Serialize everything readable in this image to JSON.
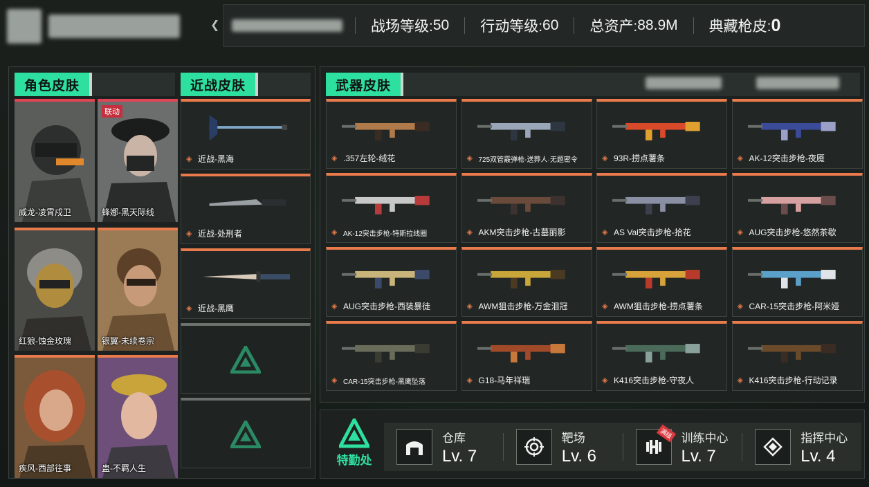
{
  "topbar": {
    "stats": [
      {
        "label": "战场等级:",
        "value": "50"
      },
      {
        "label": "行动等级: ",
        "value": "60"
      },
      {
        "label": "总资产:",
        "value": "88.9M"
      },
      {
        "label": "典藏枪皮:",
        "value": "0"
      }
    ],
    "collapse_icon": "chevron-left-icon"
  },
  "sections": {
    "character": "角色皮肤",
    "melee": "近战皮肤",
    "weapon": "武器皮肤"
  },
  "characters": [
    {
      "name": "威龙-凌霄戍卫",
      "linked": ""
    },
    {
      "name": "蜂娜-黑天际线",
      "linked": "联动"
    },
    {
      "name": "红狼-蚀金玫瑰",
      "linked": ""
    },
    {
      "name": "银翼-未续卷宗",
      "linked": ""
    },
    {
      "name": "疾风-西部往事",
      "linked": ""
    },
    {
      "name": "蛊-不羁人生",
      "linked": ""
    }
  ],
  "melee": [
    {
      "name": "近战-黑海"
    },
    {
      "name": "近战-处刑者"
    },
    {
      "name": "近战-黑鹰"
    }
  ],
  "weapons": [
    {
      "name": ".357左轮-绒花"
    },
    {
      "name": "725双管霰弹枪-送葬人·无题密令"
    },
    {
      "name": "93R-捞点薯条"
    },
    {
      "name": "AK-12突击步枪-夜魇"
    },
    {
      "name": "AK-12突击步枪-特斯拉线圈"
    },
    {
      "name": "AKM突击步枪-古墓丽影"
    },
    {
      "name": "AS Val突击步枪-拾花"
    },
    {
      "name": "AUG突击步枪-悠然茶歇"
    },
    {
      "name": "AUG突击步枪-西装暴徒"
    },
    {
      "name": "AWM狙击步枪-万金泪冠"
    },
    {
      "name": "AWM狙击步枪-捞点薯条"
    },
    {
      "name": "CAR-15突击步枪-阿米娅"
    },
    {
      "name": "CAR-15突击步枪-黑鹰坠落"
    },
    {
      "name": "G18-马年祥瑞"
    },
    {
      "name": "K416突击步枪-守夜人"
    },
    {
      "name": "K416突击步枪-行动记录"
    }
  ],
  "agency": {
    "label": "特勤处"
  },
  "facilities": [
    {
      "name": "仓库",
      "level": "Lv. 7",
      "icon": "warehouse-icon",
      "badge": ""
    },
    {
      "name": "靶场",
      "level": "Lv. 6",
      "icon": "target-icon",
      "badge": ""
    },
    {
      "name": "训练中心",
      "level": "Lv. 7",
      "icon": "dumbbell-icon",
      "badge": "满级"
    },
    {
      "name": "指挥中心",
      "level": "Lv. 4",
      "icon": "chip-icon",
      "badge": ""
    }
  ],
  "colors": {
    "accent": "#2de0a0",
    "card_border": "#e87a4b",
    "linked_badge": "#c6303e"
  }
}
